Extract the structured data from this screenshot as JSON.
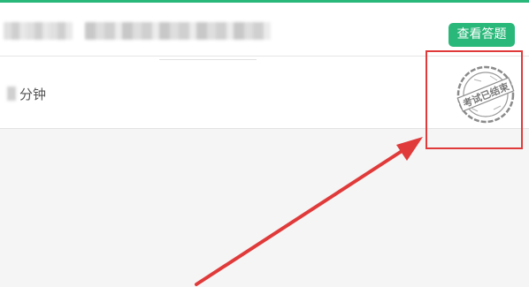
{
  "header": {
    "view_answers_label": "查看答题"
  },
  "exam": {
    "duration_text": "分钟"
  },
  "stamp": {
    "text": "考试已结束"
  },
  "colors": {
    "accent": "#2ab87a",
    "annotation": "#e03a3a",
    "stamp": "#8a8a8a"
  }
}
